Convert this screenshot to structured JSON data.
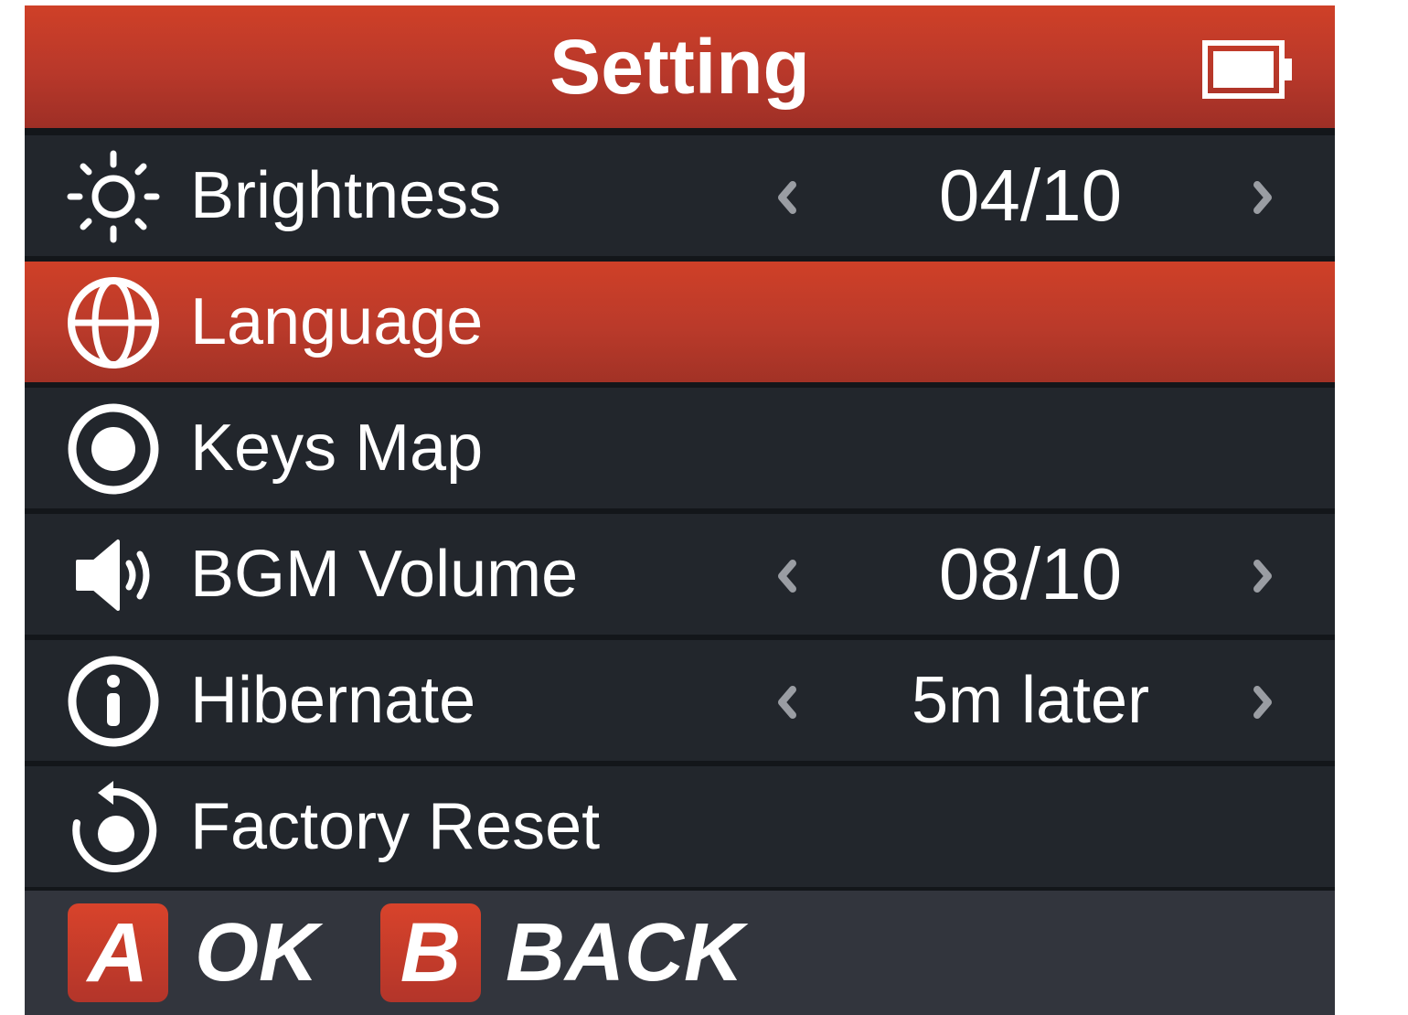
{
  "header": {
    "title": "Setting",
    "battery_icon": "battery-icon"
  },
  "settings": [
    {
      "icon": "sun-icon",
      "label": "Brightness",
      "value": "04/10",
      "adjustable": true,
      "selected": false
    },
    {
      "icon": "globe-icon",
      "label": "Language",
      "value": "",
      "adjustable": false,
      "selected": true
    },
    {
      "icon": "radio-dot-icon",
      "label": "Keys Map",
      "value": "",
      "adjustable": false,
      "selected": false
    },
    {
      "icon": "speaker-icon",
      "label": "BGM Volume",
      "value": "08/10",
      "adjustable": true,
      "selected": false
    },
    {
      "icon": "info-icon",
      "label": "Hibernate",
      "value": "5m later",
      "adjustable": true,
      "selected": false
    },
    {
      "icon": "reset-icon",
      "label": "Factory Reset",
      "value": "",
      "adjustable": false,
      "selected": false
    }
  ],
  "footer": {
    "ok_key": "A",
    "ok_label": "OK",
    "back_key": "B",
    "back_label": "BACK"
  },
  "colors": {
    "accent": "#c23b29",
    "row_bg": "#22262c",
    "footer_bg": "#32353d",
    "arrow": "#9a9da3",
    "text": "#ffffff"
  }
}
